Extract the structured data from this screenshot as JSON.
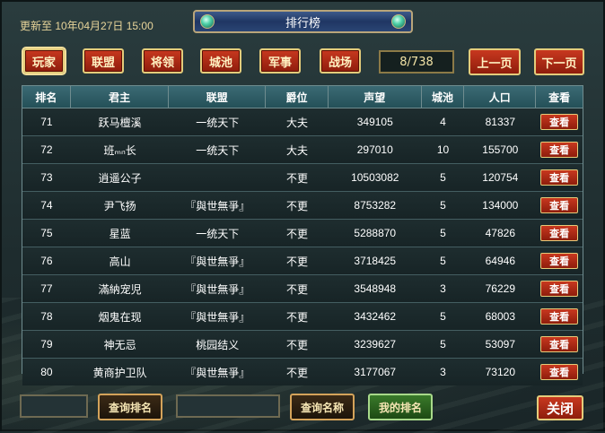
{
  "header": {
    "updated_text": "更新至  10年04月27日  15:00",
    "title": "排行榜"
  },
  "categories": [
    {
      "label": "玩家",
      "active": true
    },
    {
      "label": "联盟",
      "active": false
    },
    {
      "label": "将领",
      "active": false
    },
    {
      "label": "城池",
      "active": false
    },
    {
      "label": "军事",
      "active": false
    },
    {
      "label": "战场",
      "active": false
    }
  ],
  "pagination": {
    "counter": "8/738",
    "prev_label": "上一页",
    "next_label": "下一页"
  },
  "table": {
    "columns": [
      "排名",
      "君主",
      "联盟",
      "爵位",
      "声望",
      "城池",
      "人口",
      "查看"
    ],
    "view_label": "查看",
    "rows": [
      {
        "rank": "71",
        "lord": "跃马檀溪",
        "alliance": "一统天下",
        "title": "大夫",
        "prestige": "349105",
        "cities": "4",
        "population": "81337"
      },
      {
        "rank": "72",
        "lord": "班ₘₙ长",
        "alliance": "一统天下",
        "title": "大夫",
        "prestige": "297010",
        "cities": "10",
        "population": "155700"
      },
      {
        "rank": "73",
        "lord": "逍遥公子",
        "alliance": "",
        "title": "不更",
        "prestige": "10503082",
        "cities": "5",
        "population": "120754"
      },
      {
        "rank": "74",
        "lord": "尹飞扬",
        "alliance": "『與世無爭』",
        "title": "不更",
        "prestige": "8753282",
        "cities": "5",
        "population": "134000"
      },
      {
        "rank": "75",
        "lord": "星蓝",
        "alliance": "一统天下",
        "title": "不更",
        "prestige": "5288870",
        "cities": "5",
        "population": "47826"
      },
      {
        "rank": "76",
        "lord": "高山",
        "alliance": "『與世無爭』",
        "title": "不更",
        "prestige": "3718425",
        "cities": "5",
        "population": "64946"
      },
      {
        "rank": "77",
        "lord": "滿納宠児",
        "alliance": "『與世無爭』",
        "title": "不更",
        "prestige": "3548948",
        "cities": "3",
        "population": "76229"
      },
      {
        "rank": "78",
        "lord": "烟鬼在现",
        "alliance": "『與世無爭』",
        "title": "不更",
        "prestige": "3432462",
        "cities": "5",
        "population": "68003"
      },
      {
        "rank": "79",
        "lord": "神无忌",
        "alliance": "桃园结义",
        "title": "不更",
        "prestige": "3239627",
        "cities": "5",
        "population": "53097"
      },
      {
        "rank": "80",
        "lord": "黄商护卫队",
        "alliance": "『與世無爭』",
        "title": "不更",
        "prestige": "3177067",
        "cities": "3",
        "population": "73120"
      }
    ]
  },
  "footer": {
    "rank_input_value": "",
    "query_rank_label": "查询排名",
    "name_input_value": "",
    "query_name_label": "查询名称",
    "my_rank_label": "我的排名",
    "close_label": "关闭"
  },
  "colors": {
    "accent_red": "#a8280f",
    "gold_border": "#e4cc7b",
    "header_teal": "#2f5e66"
  }
}
